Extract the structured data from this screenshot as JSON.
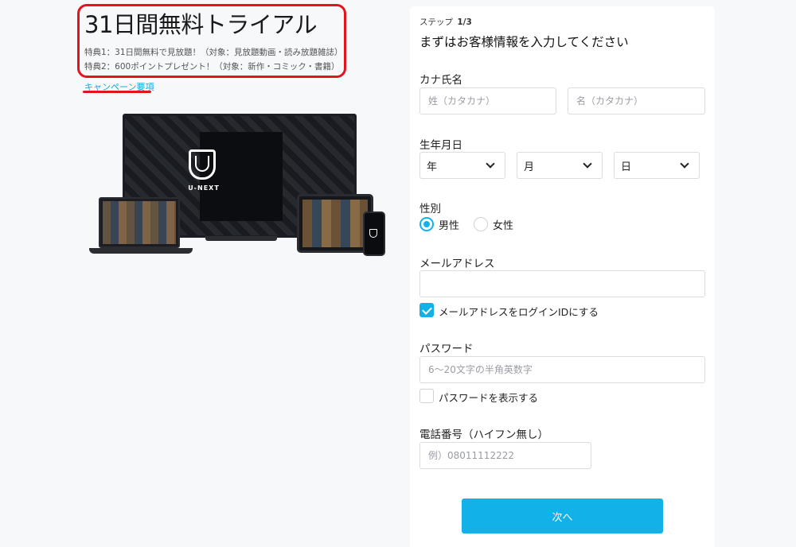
{
  "campaign": {
    "title": "31日間無料トライアル",
    "benefit1": "特典1：31日間無料で見放題！（対象：見放題動画・読み放題雑誌）",
    "benefit2": "特典2：600ポイントプレゼント！（対象：新作・コミック・書籍）",
    "link_label": "キャンペーン要項",
    "highlight_color": "#e3131f",
    "link_color": "#1aa7dd"
  },
  "devices": {
    "brand": "U-NEXT"
  },
  "form": {
    "step_label": "ステップ",
    "step_value": "1/3",
    "heading": "まずはお客様情報を入力してください",
    "kana": {
      "label": "カナ氏名",
      "last_placeholder": "姓（カタカナ）",
      "first_placeholder": "名（カタカナ）"
    },
    "birthdate": {
      "label": "生年月日",
      "year": "年",
      "month": "月",
      "day": "日",
      "icon": "chevron-down-icon"
    },
    "gender": {
      "label": "性別",
      "options": [
        {
          "label": "男性",
          "selected": true
        },
        {
          "label": "女性",
          "selected": false
        }
      ]
    },
    "email": {
      "label": "メールアドレス",
      "value": "",
      "use_as_login_label": "メールアドレスをログインIDにする",
      "use_as_login_checked": true
    },
    "password": {
      "label": "パスワード",
      "placeholder": "6～20文字の半角英数字",
      "show_label": "パスワードを表示する",
      "show_checked": false
    },
    "phone": {
      "label": "電話番号（ハイフン無し）",
      "placeholder": "例）08011112222"
    },
    "next_label": "次へ",
    "accent_color": "#12b2e8"
  }
}
